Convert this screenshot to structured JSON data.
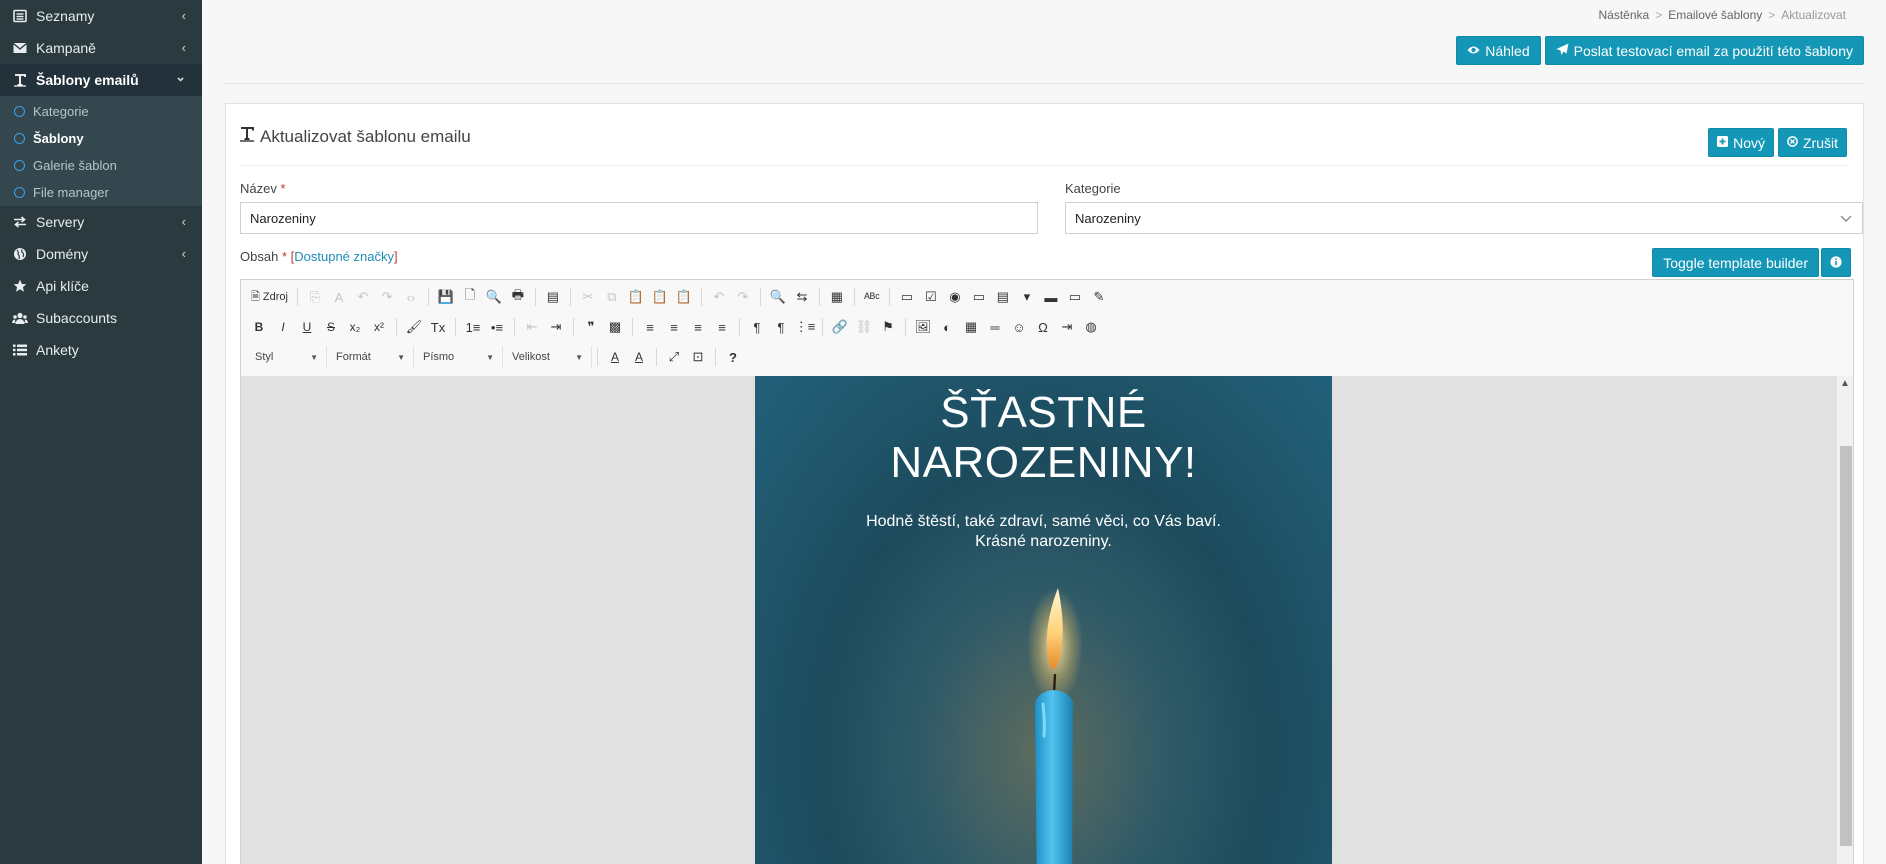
{
  "sidebar": {
    "items": [
      {
        "label": "Seznamy",
        "icon": "list-alt-icon",
        "chevron": "‹"
      },
      {
        "label": "Kampaně",
        "icon": "envelope-icon",
        "chevron": "‹"
      },
      {
        "label": "Šablony emailů",
        "icon": "text-icon",
        "chevron": "⌄"
      },
      {
        "label": "Servery",
        "icon": "exchange-icon",
        "chevron": "‹"
      },
      {
        "label": "Domény",
        "icon": "globe-icon",
        "chevron": "‹"
      },
      {
        "label": "Api klíče",
        "icon": "star-icon"
      },
      {
        "label": "Subaccounts",
        "icon": "users-icon"
      },
      {
        "label": "Ankety",
        "icon": "list-icon"
      }
    ],
    "subitems": [
      {
        "label": "Kategorie"
      },
      {
        "label": "Šablony"
      },
      {
        "label": "Galerie šablon"
      },
      {
        "label": "File manager"
      }
    ]
  },
  "breadcrumb": {
    "items": [
      "Nástěnka",
      "Emailové šablony",
      "Aktualizovat"
    ],
    "separator": ">"
  },
  "topbar": {
    "preview_label": "Náhled",
    "send_test_label": "Poslat testovací email za použití této šablony"
  },
  "panel": {
    "title": "Aktualizovat šablonu emailu",
    "new_label": "Nový",
    "cancel_label": "Zrušit"
  },
  "form": {
    "name_label": "Název",
    "required_mark": "*",
    "name_value": "Narozeniny",
    "category_label": "Kategorie",
    "category_value": "Narozeniny",
    "content_label": "Obsah",
    "tags_link": "Dostupné značky",
    "bracket_open": "[",
    "bracket_close": "]",
    "toggle_builder_label": "Toggle template builder"
  },
  "editor": {
    "source_label": "Zdroj",
    "combos": [
      "Styl",
      "Formát",
      "Písmo",
      "Velikost"
    ],
    "toolbar_row1": [
      {
        "g": "⎘",
        "name": "cut-disabled-icon",
        "dis": true
      },
      {
        "g": "A",
        "name": "paste-text-disabled-icon",
        "dis": true
      },
      {
        "g": "↶",
        "name": "undo-disabled-icon",
        "dis": true
      },
      {
        "g": "↷",
        "name": "redo-disabled-icon",
        "dis": true
      },
      {
        "g": "‹›",
        "name": "code-disabled-icon",
        "dis": true
      }
    ],
    "toolbar_row1b": [
      {
        "g": "💾",
        "name": "save-icon"
      },
      {
        "g": "🗋",
        "name": "new-page-icon"
      },
      {
        "g": "🔍",
        "name": "preview-icon"
      },
      {
        "g": "🖶",
        "name": "print-icon"
      }
    ],
    "toolbar_row1c": [
      {
        "g": "▤",
        "name": "templates-icon"
      }
    ],
    "toolbar_row1d": [
      {
        "g": "✂",
        "name": "cut-icon",
        "dis": true
      },
      {
        "g": "⧉",
        "name": "copy-icon",
        "dis": true
      },
      {
        "g": "📋",
        "name": "paste-icon"
      },
      {
        "g": "📋",
        "name": "paste-text-icon"
      },
      {
        "g": "📋",
        "name": "paste-word-icon"
      }
    ],
    "toolbar_row1e": [
      {
        "g": "↶",
        "name": "undo-icon",
        "dis": true
      },
      {
        "g": "↷",
        "name": "redo-icon",
        "dis": true
      }
    ],
    "toolbar_row1f": [
      {
        "g": "🔍",
        "name": "find-icon"
      },
      {
        "g": "⇆",
        "name": "replace-icon"
      }
    ],
    "toolbar_row1g": [
      {
        "g": "▦",
        "name": "select-all-icon"
      }
    ],
    "toolbar_row1h": [
      {
        "g": "ᴬᴮᶜ",
        "name": "spellcheck-icon"
      }
    ],
    "toolbar_row1i": [
      {
        "g": "▭",
        "name": "form-icon"
      },
      {
        "g": "☑",
        "name": "checkbox-icon"
      },
      {
        "g": "◉",
        "name": "radio-icon"
      },
      {
        "g": "▭",
        "name": "textfield-icon"
      },
      {
        "g": "▤",
        "name": "textarea-icon"
      },
      {
        "g": "▾",
        "name": "select-icon"
      },
      {
        "g": "▬",
        "name": "button-icon"
      },
      {
        "g": "▭",
        "name": "imagebutton-icon"
      },
      {
        "g": "✎",
        "name": "hiddenfield-icon"
      }
    ],
    "toolbar_row2a": [
      {
        "g": "B",
        "name": "bold-icon"
      },
      {
        "g": "I",
        "name": "italic-icon"
      },
      {
        "g": "U",
        "name": "underline-icon"
      },
      {
        "g": "S",
        "name": "strike-icon"
      },
      {
        "g": "x₂",
        "name": "subscript-icon"
      },
      {
        "g": "x²",
        "name": "superscript-icon"
      }
    ],
    "toolbar_row2b": [
      {
        "g": "🖌",
        "name": "copy-format-icon"
      },
      {
        "g": "Tx",
        "name": "remove-format-icon"
      }
    ],
    "toolbar_row2c": [
      {
        "g": "1≡",
        "name": "numbered-list-icon"
      },
      {
        "g": "•≡",
        "name": "bulleted-list-icon"
      }
    ],
    "toolbar_row2d": [
      {
        "g": "⇤",
        "name": "outdent-icon",
        "dis": true
      },
      {
        "g": "⇥",
        "name": "indent-icon"
      }
    ],
    "toolbar_row2e": [
      {
        "g": "❞",
        "name": "blockquote-icon"
      },
      {
        "g": "▩",
        "name": "div-icon"
      }
    ],
    "toolbar_row2f": [
      {
        "g": "≡",
        "name": "align-left-icon"
      },
      {
        "g": "≡",
        "name": "align-center-icon"
      },
      {
        "g": "≡",
        "name": "align-right-icon"
      },
      {
        "g": "≡",
        "name": "justify-icon"
      }
    ],
    "toolbar_row2g": [
      {
        "g": "¶",
        "name": "ltr-icon"
      },
      {
        "g": "¶",
        "name": "rtl-icon"
      },
      {
        "g": "⋮≡",
        "name": "language-icon"
      }
    ],
    "toolbar_row2h": [
      {
        "g": "🔗",
        "name": "link-icon"
      },
      {
        "g": "⛓",
        "name": "unlink-icon",
        "dis": true
      },
      {
        "g": "⚑",
        "name": "anchor-icon"
      }
    ],
    "toolbar_row2i": [
      {
        "g": "🖼",
        "name": "image-icon"
      },
      {
        "g": "◐",
        "name": "flash-icon"
      },
      {
        "g": "▦",
        "name": "table-icon"
      },
      {
        "g": "═",
        "name": "horizontal-line-icon"
      },
      {
        "g": "☺",
        "name": "smiley-icon"
      },
      {
        "g": "Ω",
        "name": "special-char-icon"
      },
      {
        "g": "⇥",
        "name": "page-break-icon"
      },
      {
        "g": "◍",
        "name": "iframe-icon"
      }
    ],
    "toolbar_row3": [
      {
        "g": "A",
        "name": "text-color-icon"
      },
      {
        "g": "A",
        "name": "bg-color-icon"
      }
    ],
    "toolbar_row3b": [
      {
        "g": "⤢",
        "name": "maximize-icon"
      },
      {
        "g": "⊡",
        "name": "show-blocks-icon"
      }
    ],
    "toolbar_row3c": [
      {
        "g": "?",
        "name": "help-icon"
      }
    ]
  },
  "email": {
    "title_line1": "ŠŤASTNÉ",
    "title_line2": "NAROZENINY!",
    "message_line1": "Hodně štěstí, také zdraví, samé věci, co Vás baví.",
    "message_line2": "Krásné narozeniny."
  },
  "colors": {
    "accent": "#1497b7",
    "sidebar": "#2a3a3f",
    "sub_icon": "#3aa0e4"
  }
}
